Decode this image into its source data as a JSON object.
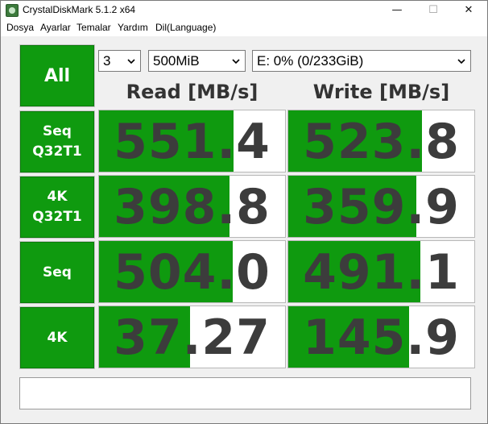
{
  "window": {
    "title": "CrystalDiskMark 5.1.2 x64"
  },
  "controls": {
    "minimize": "—",
    "maximize": "☐",
    "close": "✕"
  },
  "menu": [
    "Dosya",
    "Ayarlar",
    "Temalar",
    "Yardım",
    "Dil(Language)"
  ],
  "all_button": "All",
  "selects": {
    "count": "3",
    "size": "500MiB",
    "drive": "E: 0% (0/233GiB)"
  },
  "headers": {
    "read": "Read [MB/s]",
    "write": "Write [MB/s]"
  },
  "rows": [
    {
      "label_line1": "Seq",
      "label_line2": "Q32T1",
      "read": "551.4",
      "write": "523.8"
    },
    {
      "label_line1": "4K",
      "label_line2": "Q32T1",
      "read": "398.8",
      "write": "359.9"
    },
    {
      "label_line1": "Seq",
      "label_line2": "",
      "read": "504.0",
      "write": "491.1"
    },
    {
      "label_line1": "4K",
      "label_line2": "",
      "read": "37.27",
      "write": "145.9"
    }
  ],
  "bar_fill_fraction": [
    {
      "read": 0.725,
      "write": 0.72
    },
    {
      "read": 0.7,
      "write": 0.69
    },
    {
      "read": 0.72,
      "write": 0.71
    },
    {
      "read": 0.49,
      "write": 0.65
    }
  ],
  "colors": {
    "accent_green": "#0f9a0f",
    "value_text": "#3c3c3c"
  },
  "status_text": ""
}
